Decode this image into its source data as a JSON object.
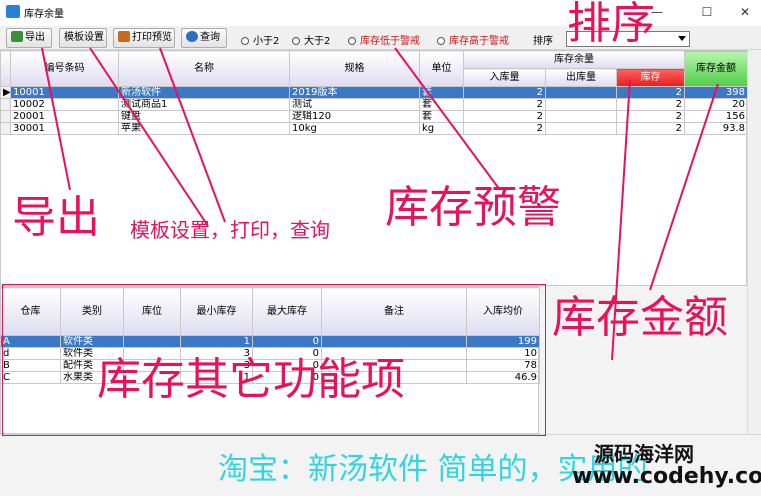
{
  "window": {
    "title": "库存余量",
    "minimize": "—",
    "maximize": "☐",
    "close": "✕"
  },
  "toolbar": {
    "export": "导出",
    "template": "模板设置",
    "print_preview": "打印预览",
    "query": "查询",
    "radio_less": "小于2",
    "radio_greater": "大于2",
    "radio_below_warn": "库存低于警戒",
    "radio_above_warn": "库存高于警戒",
    "sort_label": "排序",
    "sort_value": ""
  },
  "grid1": {
    "headers": {
      "code": "编号条码",
      "name": "名称",
      "spec": "规格",
      "unit": "单位",
      "remain_group": "库存余量",
      "in": "入库量",
      "out": "出库量",
      "stock": "库存",
      "amount": "库存金额"
    },
    "rows": [
      {
        "code": "10001",
        "name": "新汤软件",
        "spec": "2019版本",
        "unit": "套",
        "in": "2",
        "out": "",
        "stock": "2",
        "amount": "398"
      },
      {
        "code": "10002",
        "name": "测试商品1",
        "spec": "测试",
        "unit": "套",
        "in": "2",
        "out": "",
        "stock": "2",
        "amount": "20"
      },
      {
        "code": "20001",
        "name": "键盘",
        "spec": "逻辑120",
        "unit": "套",
        "in": "2",
        "out": "",
        "stock": "2",
        "amount": "156"
      },
      {
        "code": "30001",
        "name": "苹果",
        "spec": "10kg",
        "unit": "kg",
        "in": "2",
        "out": "",
        "stock": "2",
        "amount": "93.8"
      }
    ]
  },
  "grid2": {
    "headers": {
      "warehouse": "仓库",
      "category": "类别",
      "location": "库位",
      "min": "最小库存",
      "max": "最大库存",
      "note": "备注",
      "avg_price": "入库均价"
    },
    "rows": [
      {
        "warehouse": "A",
        "category": "软件类",
        "location": "",
        "min": "1",
        "max": "0",
        "note": "",
        "avg_price": "199"
      },
      {
        "warehouse": "d",
        "category": "软件类",
        "location": "",
        "min": "3",
        "max": "0",
        "note": "",
        "avg_price": "10"
      },
      {
        "warehouse": "B",
        "category": "配件类",
        "location": "",
        "min": "3",
        "max": "0",
        "note": "",
        "avg_price": "78"
      },
      {
        "warehouse": "C",
        "category": "水果类",
        "location": "",
        "min": "1",
        "max": "0",
        "note": "",
        "avg_price": "46.9"
      }
    ]
  },
  "annotations": {
    "sort": "排序",
    "export": "导出",
    "template_print_query": "模板设置，打印，查询",
    "stock_warning": "库存预警",
    "stock_amount": "库存金额",
    "other_functions": "库存其它功能项",
    "taobao": "淘宝：新汤软件 简单的，实用的",
    "watermark_cn": "源码海洋网",
    "watermark_url": "www.codehy.com"
  },
  "colors": {
    "selected_row": "#3b79c6",
    "annotation": "#e8115a",
    "stock_header": "#e61e1e",
    "amount_header": "#4fcf46"
  }
}
